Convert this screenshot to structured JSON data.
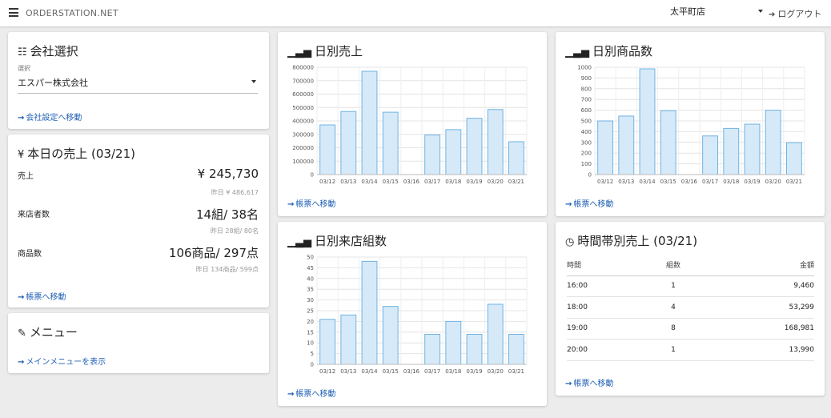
{
  "header": {
    "brand": "ORDERSTATION.NET",
    "store": "太平町店",
    "logout": "ログアウト"
  },
  "company": {
    "title": "会社選択",
    "select_label": "選択",
    "select_value": "エスパー株式会社",
    "link": "会社設定へ移動"
  },
  "today": {
    "title": "本日の売上 (03/21)",
    "rows": [
      {
        "label": "売上",
        "value": "¥ 245,730",
        "sub": "昨日 ¥ 486,617"
      },
      {
        "label": "来店者数",
        "value": "14組/ 38名",
        "sub": "昨日 28組/ 80名"
      },
      {
        "label": "商品数",
        "value": "106商品/ 297点",
        "sub": "昨日 134商品/ 599点"
      }
    ],
    "link": "帳票へ移動"
  },
  "menu": {
    "title": "メニュー",
    "link": "メインメニューを表示"
  },
  "hourly": {
    "title": "時間帯別売上 (03/21)",
    "columns": [
      "時間",
      "組数",
      "金額"
    ],
    "rows": [
      [
        "16:00",
        "1",
        "9,460"
      ],
      [
        "18:00",
        "4",
        "53,299"
      ],
      [
        "19:00",
        "8",
        "168,981"
      ],
      [
        "20:00",
        "1",
        "13,990"
      ]
    ],
    "link": "帳票へ移動"
  },
  "colors": {
    "bar_fill": "#d6e9f8",
    "bar_stroke": "#6fb3e3",
    "link": "#1f5fb5"
  },
  "chart_data": [
    {
      "type": "bar",
      "title": "日別売上",
      "categories": [
        "03/12",
        "03/13",
        "03/14",
        "03/15",
        "03/16",
        "03/17",
        "03/18",
        "03/19",
        "03/20",
        "03/21"
      ],
      "values": [
        370000,
        470000,
        770000,
        465000,
        0,
        295000,
        335000,
        420000,
        485000,
        245000
      ],
      "yticks": [
        "0",
        "100000",
        "200000",
        "300000",
        "400000",
        "500000",
        "600000",
        "700000",
        "800000"
      ],
      "ylim": [
        0,
        800000
      ],
      "link": "帳票へ移動"
    },
    {
      "type": "bar",
      "title": "日別商品数",
      "categories": [
        "03/12",
        "03/13",
        "03/14",
        "03/15",
        "03/16",
        "03/17",
        "03/18",
        "03/19",
        "03/20",
        "03/21"
      ],
      "values": [
        500,
        545,
        985,
        595,
        0,
        360,
        430,
        470,
        600,
        297
      ],
      "yticks": [
        "0",
        "100",
        "200",
        "300",
        "400",
        "500",
        "600",
        "700",
        "800",
        "900",
        "1000"
      ],
      "ylim": [
        0,
        1000
      ],
      "link": "帳票へ移動"
    },
    {
      "type": "bar",
      "title": "日別来店組数",
      "categories": [
        "03/12",
        "03/13",
        "03/14",
        "03/15",
        "03/16",
        "03/17",
        "03/18",
        "03/19",
        "03/20",
        "03/21"
      ],
      "values": [
        21,
        23,
        48,
        27,
        0,
        14,
        20,
        14,
        28,
        14
      ],
      "yticks": [
        "0",
        "5",
        "10",
        "15",
        "20",
        "25",
        "30",
        "35",
        "40",
        "45",
        "50"
      ],
      "ylim": [
        0,
        50
      ],
      "link": "帳票へ移動"
    }
  ]
}
